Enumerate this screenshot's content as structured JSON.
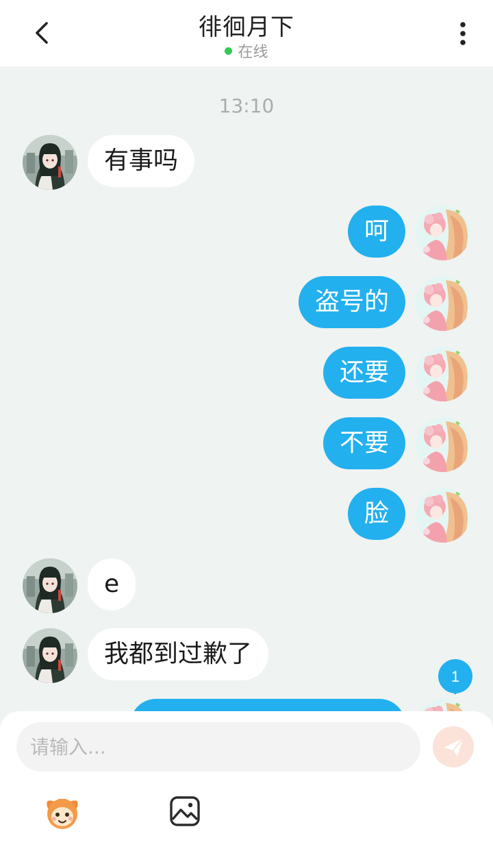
{
  "header": {
    "title": "徘徊月下",
    "status": "在线"
  },
  "conversation": {
    "timestamp": "13:10",
    "messages": [
      {
        "side": "in",
        "text": "有事吗"
      },
      {
        "side": "out",
        "text": "呵"
      },
      {
        "side": "out",
        "text": "盗号的"
      },
      {
        "side": "out",
        "text": "还要"
      },
      {
        "side": "out",
        "text": "不要"
      },
      {
        "side": "out",
        "text": "脸"
      },
      {
        "side": "in",
        "text": "e"
      },
      {
        "side": "in",
        "text": "我都到过歉了"
      },
      {
        "side": "out",
        "text": ""
      }
    ],
    "new_message_badge": "1"
  },
  "composer": {
    "placeholder": "请输入..."
  },
  "icons": {
    "back": "chevron-left-icon",
    "more": "more-vertical-icon",
    "send": "send-icon",
    "emoji": "emoji-mascot-icon",
    "image": "image-icon"
  },
  "colors": {
    "outgoing_bubble": "#23b0ee",
    "incoming_bubble": "#ffffff",
    "online_dot": "#2ecc55",
    "background": "#eff3f2",
    "send_button": "#fbe3da",
    "badge": "#23b0ee"
  }
}
